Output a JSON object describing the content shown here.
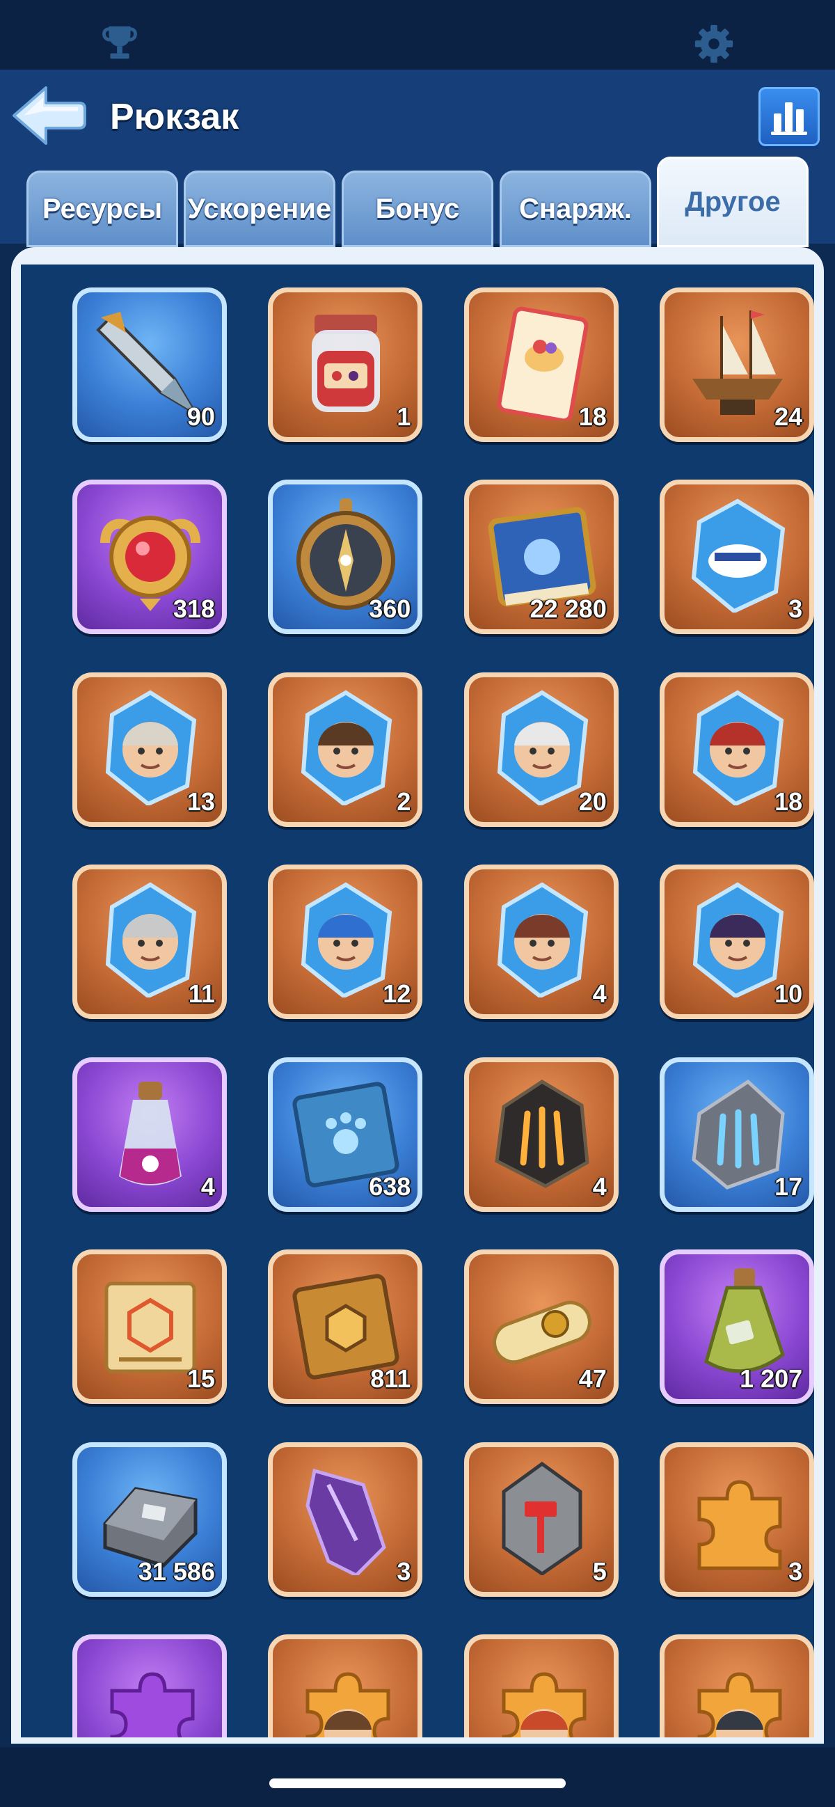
{
  "header": {
    "title": "Рюкзак"
  },
  "tabs": [
    {
      "label": "Ресурсы"
    },
    {
      "label": "Ускорение"
    },
    {
      "label": "Бонус"
    },
    {
      "label": "Снаряж."
    },
    {
      "label": "Другое",
      "active": true
    }
  ],
  "colors": {
    "background": "#0d2a52",
    "panel": "#0f3a6e",
    "tab": "#6f9ad0",
    "active_tab": "#eef5fc"
  },
  "items": [
    {
      "icon": "feather-dart-icon",
      "frame": "blue",
      "qty": "90"
    },
    {
      "icon": "jam-jar-icon",
      "frame": "orange",
      "qty": "1"
    },
    {
      "icon": "dessert-ticket-icon",
      "frame": "orange",
      "qty": "18"
    },
    {
      "icon": "ship-model-icon",
      "frame": "orange",
      "qty": "24"
    },
    {
      "icon": "ruby-amulet-icon",
      "frame": "purple",
      "qty": "318"
    },
    {
      "icon": "compass-icon",
      "frame": "blue",
      "qty": "360"
    },
    {
      "icon": "blue-tome-icon",
      "frame": "orange",
      "qty": "22 280"
    },
    {
      "icon": "captain-crystal-icon",
      "frame": "orange",
      "qty": "3"
    },
    {
      "icon": "hero-crystal-elder-woman-icon",
      "frame": "orange",
      "qty": "13"
    },
    {
      "icon": "hero-crystal-bearded-dwarf-icon",
      "frame": "orange",
      "qty": "2"
    },
    {
      "icon": "hero-crystal-old-sage-icon",
      "frame": "orange",
      "qty": "20"
    },
    {
      "icon": "hero-crystal-red-beard-icon",
      "frame": "orange",
      "qty": "18"
    },
    {
      "icon": "hero-crystal-silver-hair-icon",
      "frame": "orange",
      "qty": "11"
    },
    {
      "icon": "hero-crystal-blue-hair-icon",
      "frame": "orange",
      "qty": "12"
    },
    {
      "icon": "hero-crystal-goggles-girl-icon",
      "frame": "orange",
      "qty": "4"
    },
    {
      "icon": "hero-crystal-witch-icon",
      "frame": "orange",
      "qty": "10"
    },
    {
      "icon": "pet-potion-icon",
      "frame": "purple",
      "qty": "4"
    },
    {
      "icon": "paw-book-icon",
      "frame": "blue",
      "qty": "638"
    },
    {
      "icon": "dark-claw-stone-icon",
      "frame": "orange",
      "qty": "4"
    },
    {
      "icon": "grey-claw-stone-icon",
      "frame": "blue",
      "qty": "17"
    },
    {
      "icon": "recipe-scroll-icon",
      "frame": "orange",
      "qty": "15"
    },
    {
      "icon": "gold-rune-book-icon",
      "frame": "orange",
      "qty": "811"
    },
    {
      "icon": "sealed-scroll-icon",
      "frame": "orange",
      "qty": "47"
    },
    {
      "icon": "green-potion-icon",
      "frame": "purple",
      "qty": "1 207"
    },
    {
      "icon": "iron-ingot-icon",
      "frame": "blue",
      "qty": "31 586"
    },
    {
      "icon": "purple-crystal-icon",
      "frame": "orange",
      "qty": "3"
    },
    {
      "icon": "hammer-stone-icon",
      "frame": "orange",
      "qty": "5"
    },
    {
      "icon": "puzzle-piece-icon",
      "frame": "orange",
      "qty": "3"
    },
    {
      "icon": "purple-puzzle-piece-icon",
      "frame": "purple",
      "qty": ""
    },
    {
      "icon": "hero-puzzle-girl-icon",
      "frame": "orange",
      "qty": ""
    },
    {
      "icon": "hero-puzzle-redhair-icon",
      "frame": "orange",
      "qty": ""
    },
    {
      "icon": "hero-puzzle-ninja-icon",
      "frame": "orange",
      "qty": ""
    }
  ]
}
